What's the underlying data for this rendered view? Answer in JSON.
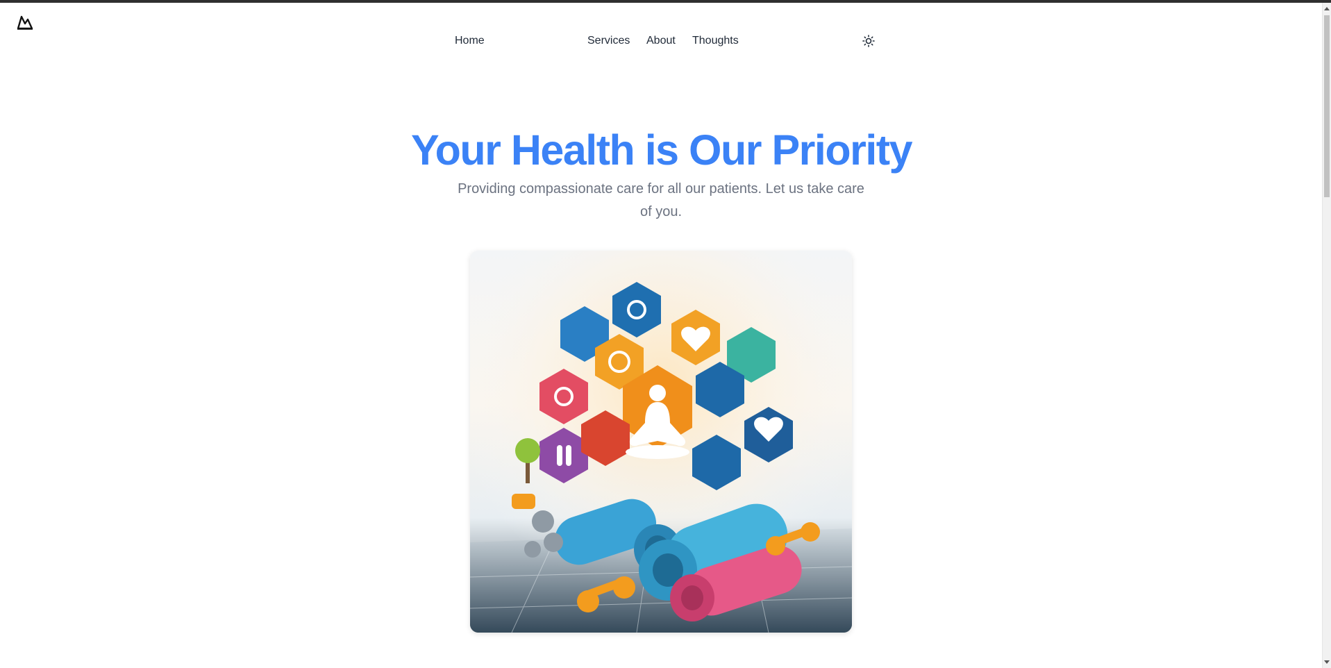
{
  "nav": {
    "home": "Home",
    "services": "Services",
    "about": "About",
    "thoughts": "Thoughts"
  },
  "icons": {
    "logo": "mountain-logo-icon",
    "theme": "sun-icon"
  },
  "hero": {
    "title": "Your Health is Our Priority",
    "subtitle": "Providing compassionate care for all our patients. Let us take care of you."
  },
  "colors": {
    "accent": "#3b82f6",
    "subtitle": "#6b7280",
    "text": "#1f2937"
  }
}
